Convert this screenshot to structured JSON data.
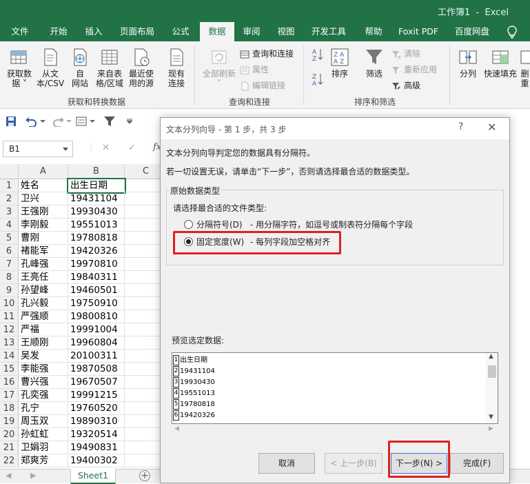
{
  "window": {
    "title": "工作簿1  -  Excel"
  },
  "ribbon_tabs": [
    "文件",
    "开始",
    "插入",
    "页面布局",
    "公式",
    "数据",
    "审阅",
    "视图",
    "开发工具",
    "帮助",
    "Foxit PDF",
    "百度网盘"
  ],
  "active_tab": "数据",
  "ribbon": {
    "get_data": {
      "label_line1": "获取数",
      "label_line2": "据 ˅"
    },
    "from_csv": {
      "label_line1": "从文",
      "label_line2": "本/CSV"
    },
    "from_web": {
      "label_line1": "自",
      "label_line2": "网站"
    },
    "from_table": {
      "label_line1": "来自表",
      "label_line2": "格/区域"
    },
    "recent_sources": {
      "label_line1": "最近使",
      "label_line2": "用的源"
    },
    "existing_conn": {
      "label_line1": "现有",
      "label_line2": "连接"
    },
    "group_get_transform": "获取和转换数据",
    "refresh_all": {
      "label_line1": "全部刷新",
      "label_line2": "˅"
    },
    "queries_connections": "查询和连接",
    "properties": "属性",
    "edit_links": "编辑链接",
    "group_queries": "查询和连接",
    "sort": "排序",
    "filter": "筛选",
    "clear": "清除",
    "reapply": "重新应用",
    "advanced": "高级",
    "group_sort_filter": "排序和筛选",
    "text_to_columns": "分列",
    "flash_fill": "快速填充",
    "remove_dup_line1": "删",
    "remove_dup_line2": "重"
  },
  "formula_bar": {
    "name_box": "B1",
    "cancel": "✕",
    "enter": "✓",
    "fx": "fx"
  },
  "columns": [
    "A",
    "B",
    "C"
  ],
  "rows": [
    {
      "n": "1",
      "a": "姓名",
      "b": "出生日期"
    },
    {
      "n": "2",
      "a": "卫兴",
      "b": "19431104"
    },
    {
      "n": "3",
      "a": "王强刚",
      "b": "19930430"
    },
    {
      "n": "4",
      "a": "李刚毅",
      "b": "19551013"
    },
    {
      "n": "5",
      "a": "曹刚",
      "b": "19780818"
    },
    {
      "n": "6",
      "a": "褚能军",
      "b": "19420326"
    },
    {
      "n": "7",
      "a": "孔峰强",
      "b": "19970810"
    },
    {
      "n": "8",
      "a": "王亮任",
      "b": "19840311"
    },
    {
      "n": "9",
      "a": "孙望峰",
      "b": "19460501"
    },
    {
      "n": "10",
      "a": "孔兴毅",
      "b": "19750910"
    },
    {
      "n": "11",
      "a": "严强顺",
      "b": "19800810"
    },
    {
      "n": "12",
      "a": "严福",
      "b": "19991004"
    },
    {
      "n": "13",
      "a": "王顺刚",
      "b": "19960804"
    },
    {
      "n": "14",
      "a": "吴发",
      "b": "20100311"
    },
    {
      "n": "15",
      "a": "李能强",
      "b": "19870508"
    },
    {
      "n": "16",
      "a": "曹兴强",
      "b": "19670507"
    },
    {
      "n": "17",
      "a": "孔奕强",
      "b": "19991215"
    },
    {
      "n": "18",
      "a": "孔宁",
      "b": "19760520"
    },
    {
      "n": "19",
      "a": "周玉双",
      "b": "19890310"
    },
    {
      "n": "20",
      "a": "孙虹虹",
      "b": "19320514"
    },
    {
      "n": "21",
      "a": "卫娟羽",
      "b": "19490831"
    },
    {
      "n": "22",
      "a": "郑爽芳",
      "b": "19400302"
    }
  ],
  "sheet": {
    "tab": "Sheet1",
    "add": "+"
  },
  "dialog": {
    "title": "文本分列向导 - 第 1 步，共 3 步",
    "help": "?",
    "close": "✕",
    "line1": "文本分列向导判定您的数据具有分隔符。",
    "line2": "若一切设置无误，请单击“下一步”，否则请选择最合适的数据类型。",
    "group_title": "原始数据类型",
    "choose_label": "请选择最合适的文件类型:",
    "opt_delimited": "分隔符号(D)",
    "opt_delimited_desc": "- 用分隔字符，如逗号或制表符分隔每个字段",
    "opt_fixed": "固定宽度(W)",
    "opt_fixed_desc": "- 每列字段加空格对齐",
    "selected_option": "fixed",
    "preview_label": "预览选定数据:",
    "preview_rows": [
      {
        "n": "1",
        "text": "出生日期"
      },
      {
        "n": "2",
        "text": "19431104"
      },
      {
        "n": "3",
        "text": "19930430"
      },
      {
        "n": "4",
        "text": "19551013"
      },
      {
        "n": "5",
        "text": "19780818"
      },
      {
        "n": "6",
        "text": "19420326"
      }
    ],
    "btn_cancel": "取消",
    "btn_back": "< 上一步(B)",
    "btn_next": "下一步(N) >",
    "btn_finish": "完成(F)"
  },
  "colors": {
    "excel_green": "#217346",
    "highlight_red": "#e02020"
  }
}
